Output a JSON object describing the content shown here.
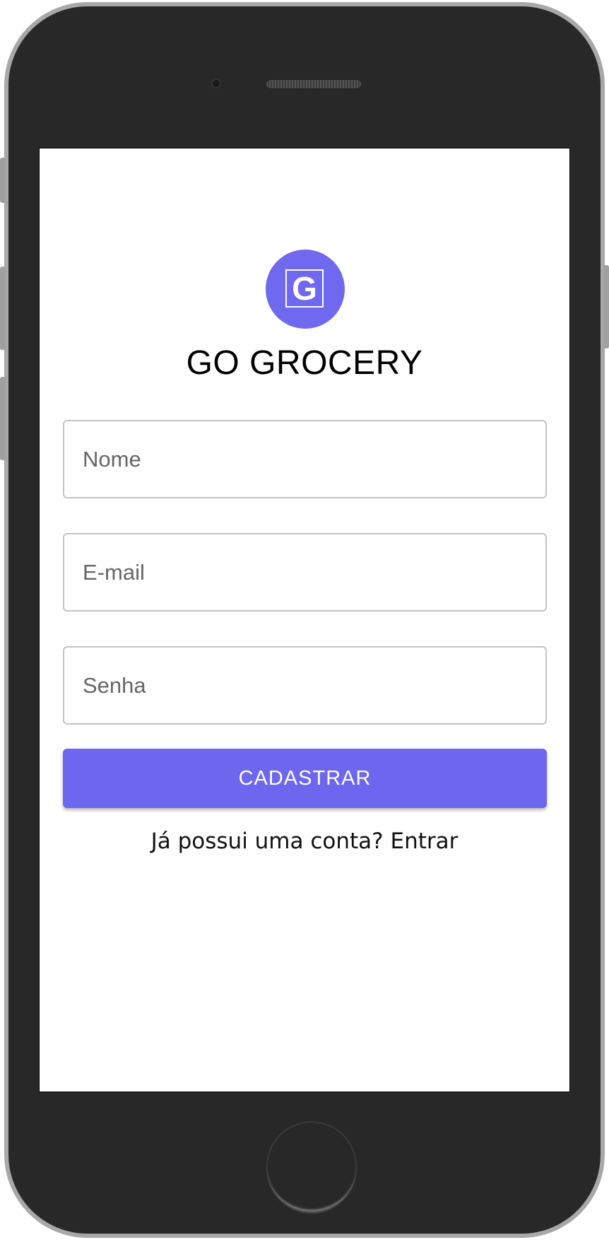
{
  "app": {
    "title": "GO GROCERY",
    "logo_letter": "G",
    "brand_color": "#6d66ee"
  },
  "form": {
    "name_placeholder": "Nome",
    "email_placeholder": "E-mail",
    "password_placeholder": "Senha",
    "submit_label": "CADASTRAR"
  },
  "footer": {
    "prompt_text": "Já possui uma conta?",
    "login_link": "Entrar"
  },
  "icons": {
    "logo": "grocery-logo-icon"
  }
}
